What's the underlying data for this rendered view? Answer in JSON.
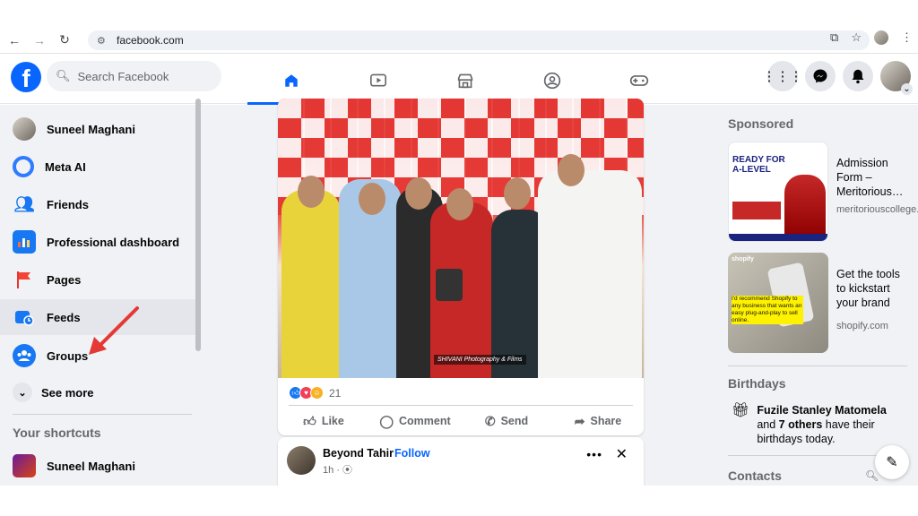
{
  "browser": {
    "url": "facebook.com"
  },
  "header": {
    "logo": "f",
    "search_placeholder": "Search Facebook"
  },
  "sidebar": {
    "items": [
      {
        "label": "Suneel Maghani"
      },
      {
        "label": "Meta AI"
      },
      {
        "label": "Friends"
      },
      {
        "label": "Professional dashboard"
      },
      {
        "label": "Pages"
      },
      {
        "label": "Feeds"
      },
      {
        "label": "Groups"
      }
    ],
    "see_more": "See more",
    "shortcuts_heading": "Your shortcuts",
    "shortcut_user": "Suneel Maghani"
  },
  "post": {
    "watermark": "SHIVANI Photography & Films",
    "reaction_count": "21",
    "actions": {
      "like": "Like",
      "comment": "Comment",
      "send": "Send",
      "share": "Share"
    }
  },
  "post2": {
    "author": "Beyond Tahir",
    "follow": "Follow",
    "time": "1h · ⦿"
  },
  "right": {
    "sponsored": "Sponsored",
    "ads": [
      {
        "title": "Admission Form – Meritorious…",
        "domain": "meritoriouscollege.com",
        "img_text": "READY FOR A-LEVEL"
      },
      {
        "title": "Get the tools to kickstart your brand",
        "domain": "shopify.com",
        "img_text": "I'd recommend Shopify to any business that wants an easy plug-and-play to sell online."
      }
    ],
    "birthdays_heading": "Birthdays",
    "birthday_name": "Fuzile Stanley Matomela",
    "birthday_and": " and ",
    "birthday_others": "7 others",
    "birthday_rest": " have their birthdays today.",
    "contacts": "Contacts"
  },
  "colors": {
    "brand": "#0866ff",
    "arrow": "#e53935"
  }
}
